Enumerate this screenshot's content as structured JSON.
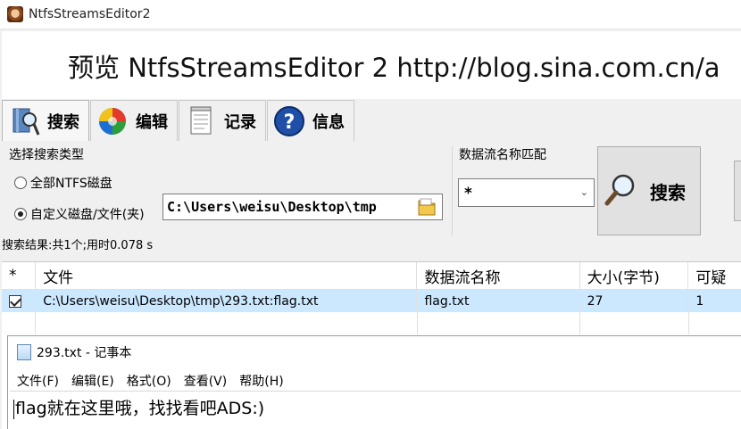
{
  "window": {
    "title": "NtfsStreamsEditor2"
  },
  "banner": {
    "text": "预览 NtfsStreamsEditor 2 http://blog.sina.com.cn/a"
  },
  "tabs": [
    {
      "label": "搜索",
      "icon": "magnifier-book-icon",
      "active": true
    },
    {
      "label": "编辑",
      "icon": "colorful-ball-icon",
      "active": false
    },
    {
      "label": "记录",
      "icon": "notepad-icon",
      "active": false
    },
    {
      "label": "信息",
      "icon": "help-question-icon",
      "active": false
    }
  ],
  "search": {
    "type_group_title": "选择搜索类型",
    "option_all": "全部NTFS磁盘",
    "option_custom": "自定义磁盘/文件(夹)",
    "selected_option": "custom",
    "path_value": "C:\\Users\\weisu\\Desktop\\tmp",
    "stream_match_title": "数据流名称匹配",
    "stream_match_value": "*",
    "search_button_label": "搜索",
    "status_text": "搜索结果:共1个;用时0.078 s"
  },
  "results": {
    "columns": [
      "*",
      "文件",
      "数据流名称",
      "大小(字节)",
      "可疑"
    ],
    "rows": [
      {
        "checked": true,
        "file": "C:\\Users\\weisu\\Desktop\\tmp\\293.txt:flag.txt",
        "stream": "flag.txt",
        "size": "27",
        "suspicious": "1"
      }
    ]
  },
  "notepad": {
    "title": "293.txt - 记事本",
    "menu": [
      "文件(F)",
      "编辑(E)",
      "格式(O)",
      "查看(V)",
      "帮助(H)"
    ],
    "content": "flag就在这里哦，找找看吧ADS:)"
  },
  "colors": {
    "selection": "#cce8ff",
    "background": "#f0f0f0"
  }
}
